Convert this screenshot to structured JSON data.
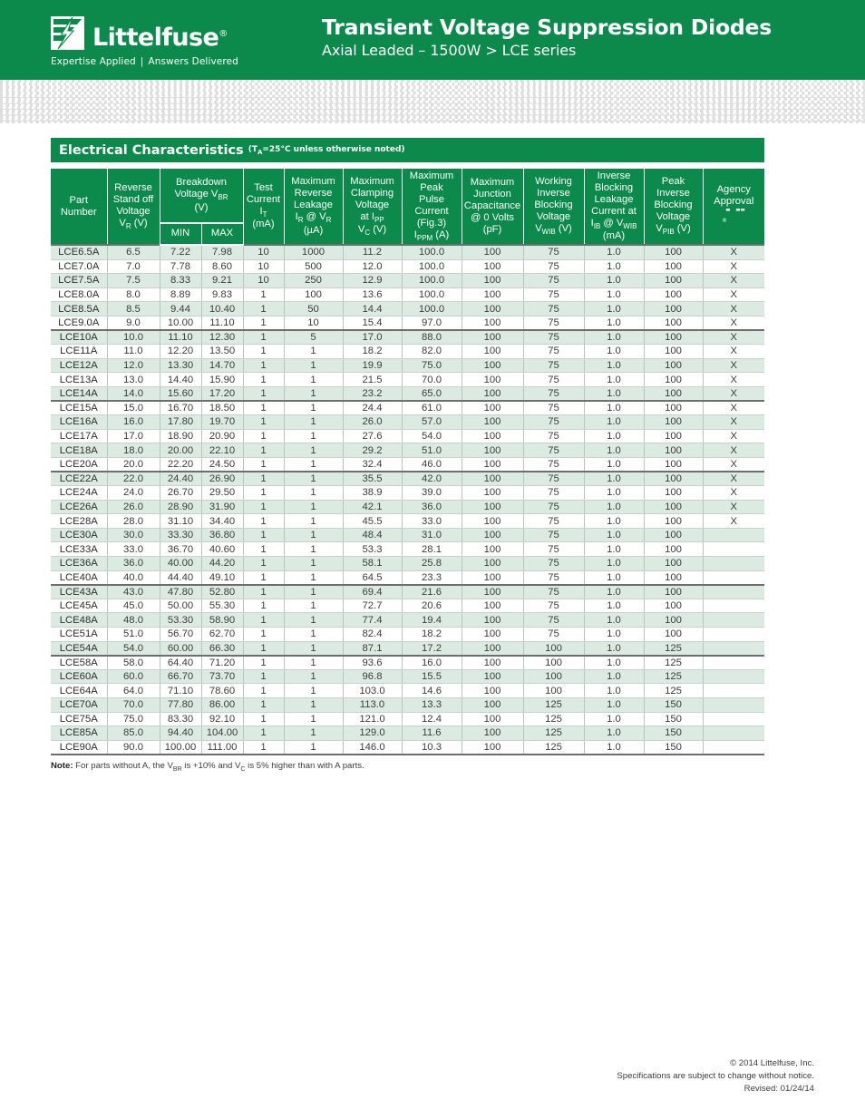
{
  "header": {
    "logo_name": "Littelfuse",
    "logo_registered": "®",
    "tagline_left": "Expertise Applied",
    "tagline_sep": "|",
    "tagline_right": "Answers Delivered",
    "title": "Transient Voltage Suppression Diodes",
    "subtitle": "Axial Leaded – 1500W  >  LCE series",
    "brand_green": "#0b8a4b"
  },
  "section": {
    "title": "Electrical Characteristics",
    "condition_prefix": "(T",
    "condition_sub": "A",
    "condition_suffix": "=25°C unless otherwise noted)"
  },
  "table": {
    "columns": [
      {
        "id": "part",
        "lines": [
          "Part",
          "Number"
        ]
      },
      {
        "id": "vr",
        "lines": [
          "Reverse",
          "Stand off",
          "Voltage"
        ],
        "symbol": "V",
        "symbol_sub": "R",
        "unit": "(V)"
      },
      {
        "id": "vbr",
        "group": true,
        "lines": [
          "Breakdown",
          "Voltage V"
        ],
        "symbol_sub": "BR",
        "unit": "(V)",
        "sub_headers": [
          "MIN",
          "MAX"
        ]
      },
      {
        "id": "it",
        "lines": [
          "Test",
          "Current"
        ],
        "symbol": "I",
        "symbol_sub": "T",
        "unit": "(mA)"
      },
      {
        "id": "ir",
        "lines": [
          "Maximum",
          "Reverse",
          "Leakage"
        ],
        "symbol": "I",
        "symbol_sub": "R",
        "symbol_tail": " @ V",
        "symbol_tail_sub": "R",
        "unit": "(µA)"
      },
      {
        "id": "vc",
        "lines": [
          "Maximum",
          "Clamping",
          "Voltage",
          "at I"
        ],
        "line_sub": "PP",
        "symbol": "V",
        "symbol_sub": "C",
        "unit": "(V)"
      },
      {
        "id": "ippm",
        "lines": [
          "Maximum",
          "Peak",
          "Pulse",
          "Current",
          "(Fig.3)"
        ],
        "symbol": "I",
        "symbol_sub": "PPM",
        "unit": "(A)"
      },
      {
        "id": "cj",
        "lines": [
          "Maximum",
          "Junction",
          "Capacitance",
          "@ 0 Volts",
          "(pF)"
        ]
      },
      {
        "id": "vwib",
        "lines": [
          "Working",
          "Inverse",
          "Blocking",
          "Voltage"
        ],
        "symbol": "V",
        "symbol_sub": "WIB",
        "unit": "(V)"
      },
      {
        "id": "iib",
        "lines": [
          "Inverse",
          "Blocking",
          "Leakage",
          "Current at"
        ],
        "symbol": "I",
        "symbol_sub": "IB",
        "symbol_tail": " @ V",
        "symbol_tail_sub": "WIB",
        "unit": "(mA)"
      },
      {
        "id": "vpib",
        "lines": [
          "Peak",
          "Inverse",
          "Blocking",
          "Voltage"
        ],
        "symbol": "V",
        "symbol_sub": "PIB",
        "unit": "(V)"
      },
      {
        "id": "agency",
        "lines": [
          "Agency",
          "Approval"
        ],
        "logo": "ul-logo"
      }
    ],
    "subheaders": {
      "min": "MIN",
      "max": "MAX"
    },
    "rows": [
      {
        "part": "LCE6.5A",
        "vr": "6.5",
        "min": "7.22",
        "max": "7.98",
        "it": "10",
        "ir": "1000",
        "vc": "11.2",
        "ippm": "100.0",
        "cj": "100",
        "vwib": "75",
        "iib": "1.0",
        "vpib": "100",
        "agency": "X"
      },
      {
        "part": "LCE7.0A",
        "vr": "7.0",
        "min": "7.78",
        "max": "8.60",
        "it": "10",
        "ir": "500",
        "vc": "12.0",
        "ippm": "100.0",
        "cj": "100",
        "vwib": "75",
        "iib": "1.0",
        "vpib": "100",
        "agency": "X"
      },
      {
        "part": "LCE7.5A",
        "vr": "7.5",
        "min": "8.33",
        "max": "9.21",
        "it": "10",
        "ir": "250",
        "vc": "12.9",
        "ippm": "100.0",
        "cj": "100",
        "vwib": "75",
        "iib": "1.0",
        "vpib": "100",
        "agency": "X"
      },
      {
        "part": "LCE8.0A",
        "vr": "8.0",
        "min": "8.89",
        "max": "9.83",
        "it": "1",
        "ir": "100",
        "vc": "13.6",
        "ippm": "100.0",
        "cj": "100",
        "vwib": "75",
        "iib": "1.0",
        "vpib": "100",
        "agency": "X"
      },
      {
        "part": "LCE8.5A",
        "vr": "8.5",
        "min": "9.44",
        "max": "10.40",
        "it": "1",
        "ir": "50",
        "vc": "14.4",
        "ippm": "100.0",
        "cj": "100",
        "vwib": "75",
        "iib": "1.0",
        "vpib": "100",
        "agency": "X"
      },
      {
        "part": "LCE9.0A",
        "vr": "9.0",
        "min": "10.00",
        "max": "11.10",
        "it": "1",
        "ir": "10",
        "vc": "15.4",
        "ippm": "97.0",
        "cj": "100",
        "vwib": "75",
        "iib": "1.0",
        "vpib": "100",
        "agency": "X",
        "group_end": true
      },
      {
        "part": "LCE10A",
        "vr": "10.0",
        "min": "11.10",
        "max": "12.30",
        "it": "1",
        "ir": "5",
        "vc": "17.0",
        "ippm": "88.0",
        "cj": "100",
        "vwib": "75",
        "iib": "1.0",
        "vpib": "100",
        "agency": "X"
      },
      {
        "part": "LCE11A",
        "vr": "11.0",
        "min": "12.20",
        "max": "13.50",
        "it": "1",
        "ir": "1",
        "vc": "18.2",
        "ippm": "82.0",
        "cj": "100",
        "vwib": "75",
        "iib": "1.0",
        "vpib": "100",
        "agency": "X"
      },
      {
        "part": "LCE12A",
        "vr": "12.0",
        "min": "13.30",
        "max": "14.70",
        "it": "1",
        "ir": "1",
        "vc": "19.9",
        "ippm": "75.0",
        "cj": "100",
        "vwib": "75",
        "iib": "1.0",
        "vpib": "100",
        "agency": "X"
      },
      {
        "part": "LCE13A",
        "vr": "13.0",
        "min": "14.40",
        "max": "15.90",
        "it": "1",
        "ir": "1",
        "vc": "21.5",
        "ippm": "70.0",
        "cj": "100",
        "vwib": "75",
        "iib": "1.0",
        "vpib": "100",
        "agency": "X"
      },
      {
        "part": "LCE14A",
        "vr": "14.0",
        "min": "15.60",
        "max": "17.20",
        "it": "1",
        "ir": "1",
        "vc": "23.2",
        "ippm": "65.0",
        "cj": "100",
        "vwib": "75",
        "iib": "1.0",
        "vpib": "100",
        "agency": "X",
        "group_end": true
      },
      {
        "part": "LCE15A",
        "vr": "15.0",
        "min": "16.70",
        "max": "18.50",
        "it": "1",
        "ir": "1",
        "vc": "24.4",
        "ippm": "61.0",
        "cj": "100",
        "vwib": "75",
        "iib": "1.0",
        "vpib": "100",
        "agency": "X"
      },
      {
        "part": "LCE16A",
        "vr": "16.0",
        "min": "17.80",
        "max": "19.70",
        "it": "1",
        "ir": "1",
        "vc": "26.0",
        "ippm": "57.0",
        "cj": "100",
        "vwib": "75",
        "iib": "1.0",
        "vpib": "100",
        "agency": "X"
      },
      {
        "part": "LCE17A",
        "vr": "17.0",
        "min": "18.90",
        "max": "20.90",
        "it": "1",
        "ir": "1",
        "vc": "27.6",
        "ippm": "54.0",
        "cj": "100",
        "vwib": "75",
        "iib": "1.0",
        "vpib": "100",
        "agency": "X"
      },
      {
        "part": "LCE18A",
        "vr": "18.0",
        "min": "20.00",
        "max": "22.10",
        "it": "1",
        "ir": "1",
        "vc": "29.2",
        "ippm": "51.0",
        "cj": "100",
        "vwib": "75",
        "iib": "1.0",
        "vpib": "100",
        "agency": "X"
      },
      {
        "part": "LCE20A",
        "vr": "20.0",
        "min": "22.20",
        "max": "24.50",
        "it": "1",
        "ir": "1",
        "vc": "32.4",
        "ippm": "46.0",
        "cj": "100",
        "vwib": "75",
        "iib": "1.0",
        "vpib": "100",
        "agency": "X",
        "group_end": true
      },
      {
        "part": "LCE22A",
        "vr": "22.0",
        "min": "24.40",
        "max": "26.90",
        "it": "1",
        "ir": "1",
        "vc": "35.5",
        "ippm": "42.0",
        "cj": "100",
        "vwib": "75",
        "iib": "1.0",
        "vpib": "100",
        "agency": "X"
      },
      {
        "part": "LCE24A",
        "vr": "24.0",
        "min": "26.70",
        "max": "29.50",
        "it": "1",
        "ir": "1",
        "vc": "38.9",
        "ippm": "39.0",
        "cj": "100",
        "vwib": "75",
        "iib": "1.0",
        "vpib": "100",
        "agency": "X"
      },
      {
        "part": "LCE26A",
        "vr": "26.0",
        "min": "28.90",
        "max": "31.90",
        "it": "1",
        "ir": "1",
        "vc": "42.1",
        "ippm": "36.0",
        "cj": "100",
        "vwib": "75",
        "iib": "1.0",
        "vpib": "100",
        "agency": "X"
      },
      {
        "part": "LCE28A",
        "vr": "28.0",
        "min": "31.10",
        "max": "34.40",
        "it": "1",
        "ir": "1",
        "vc": "45.5",
        "ippm": "33.0",
        "cj": "100",
        "vwib": "75",
        "iib": "1.0",
        "vpib": "100",
        "agency": "X"
      },
      {
        "part": "LCE30A",
        "vr": "30.0",
        "min": "33.30",
        "max": "36.80",
        "it": "1",
        "ir": "1",
        "vc": "48.4",
        "ippm": "31.0",
        "cj": "100",
        "vwib": "75",
        "iib": "1.0",
        "vpib": "100",
        "agency": ""
      },
      {
        "part": "LCE33A",
        "vr": "33.0",
        "min": "36.70",
        "max": "40.60",
        "it": "1",
        "ir": "1",
        "vc": "53.3",
        "ippm": "28.1",
        "cj": "100",
        "vwib": "75",
        "iib": "1.0",
        "vpib": "100",
        "agency": ""
      },
      {
        "part": "LCE36A",
        "vr": "36.0",
        "min": "40.00",
        "max": "44.20",
        "it": "1",
        "ir": "1",
        "vc": "58.1",
        "ippm": "25.8",
        "cj": "100",
        "vwib": "75",
        "iib": "1.0",
        "vpib": "100",
        "agency": ""
      },
      {
        "part": "LCE40A",
        "vr": "40.0",
        "min": "44.40",
        "max": "49.10",
        "it": "1",
        "ir": "1",
        "vc": "64.5",
        "ippm": "23.3",
        "cj": "100",
        "vwib": "75",
        "iib": "1.0",
        "vpib": "100",
        "agency": "",
        "group_end": true
      },
      {
        "part": "LCE43A",
        "vr": "43.0",
        "min": "47.80",
        "max": "52.80",
        "it": "1",
        "ir": "1",
        "vc": "69.4",
        "ippm": "21.6",
        "cj": "100",
        "vwib": "75",
        "iib": "1.0",
        "vpib": "100",
        "agency": ""
      },
      {
        "part": "LCE45A",
        "vr": "45.0",
        "min": "50.00",
        "max": "55.30",
        "it": "1",
        "ir": "1",
        "vc": "72.7",
        "ippm": "20.6",
        "cj": "100",
        "vwib": "75",
        "iib": "1.0",
        "vpib": "100",
        "agency": ""
      },
      {
        "part": "LCE48A",
        "vr": "48.0",
        "min": "53.30",
        "max": "58.90",
        "it": "1",
        "ir": "1",
        "vc": "77.4",
        "ippm": "19.4",
        "cj": "100",
        "vwib": "75",
        "iib": "1.0",
        "vpib": "100",
        "agency": ""
      },
      {
        "part": "LCE51A",
        "vr": "51.0",
        "min": "56.70",
        "max": "62.70",
        "it": "1",
        "ir": "1",
        "vc": "82.4",
        "ippm": "18.2",
        "cj": "100",
        "vwib": "75",
        "iib": "1.0",
        "vpib": "100",
        "agency": ""
      },
      {
        "part": "LCE54A",
        "vr": "54.0",
        "min": "60.00",
        "max": "66.30",
        "it": "1",
        "ir": "1",
        "vc": "87.1",
        "ippm": "17.2",
        "cj": "100",
        "vwib": "100",
        "iib": "1.0",
        "vpib": "125",
        "agency": "",
        "group_end": true
      },
      {
        "part": "LCE58A",
        "vr": "58.0",
        "min": "64.40",
        "max": "71.20",
        "it": "1",
        "ir": "1",
        "vc": "93.6",
        "ippm": "16.0",
        "cj": "100",
        "vwib": "100",
        "iib": "1.0",
        "vpib": "125",
        "agency": ""
      },
      {
        "part": "LCE60A",
        "vr": "60.0",
        "min": "66.70",
        "max": "73.70",
        "it": "1",
        "ir": "1",
        "vc": "96.8",
        "ippm": "15.5",
        "cj": "100",
        "vwib": "100",
        "iib": "1.0",
        "vpib": "125",
        "agency": ""
      },
      {
        "part": "LCE64A",
        "vr": "64.0",
        "min": "71.10",
        "max": "78.60",
        "it": "1",
        "ir": "1",
        "vc": "103.0",
        "ippm": "14.6",
        "cj": "100",
        "vwib": "100",
        "iib": "1.0",
        "vpib": "125",
        "agency": ""
      },
      {
        "part": "LCE70A",
        "vr": "70.0",
        "min": "77.80",
        "max": "86.00",
        "it": "1",
        "ir": "1",
        "vc": "113.0",
        "ippm": "13.3",
        "cj": "100",
        "vwib": "125",
        "iib": "1.0",
        "vpib": "150",
        "agency": ""
      },
      {
        "part": "LCE75A",
        "vr": "75.0",
        "min": "83.30",
        "max": "92.10",
        "it": "1",
        "ir": "1",
        "vc": "121.0",
        "ippm": "12.4",
        "cj": "100",
        "vwib": "125",
        "iib": "1.0",
        "vpib": "150",
        "agency": ""
      },
      {
        "part": "LCE85A",
        "vr": "85.0",
        "min": "94.40",
        "max": "104.00",
        "it": "1",
        "ir": "1",
        "vc": "129.0",
        "ippm": "11.6",
        "cj": "100",
        "vwib": "125",
        "iib": "1.0",
        "vpib": "150",
        "agency": ""
      },
      {
        "part": "LCE90A",
        "vr": "90.0",
        "min": "100.00",
        "max": "111.00",
        "it": "1",
        "ir": "1",
        "vc": "146.0",
        "ippm": "10.3",
        "cj": "100",
        "vwib": "125",
        "iib": "1.0",
        "vpib": "150",
        "agency": ""
      }
    ]
  },
  "note": {
    "label": "Note:",
    "text_1": " For parts without A, the V",
    "sub_1": "BR",
    "text_2": " is +10% and V",
    "sub_2": "C",
    "text_3": " is 5% higher than with A parts."
  },
  "footer": {
    "copyright": "© 2014 Littelfuse, Inc.",
    "disclaimer": "Specifications are subject to change without notice.",
    "revised": "Revised: 01/24/14"
  }
}
